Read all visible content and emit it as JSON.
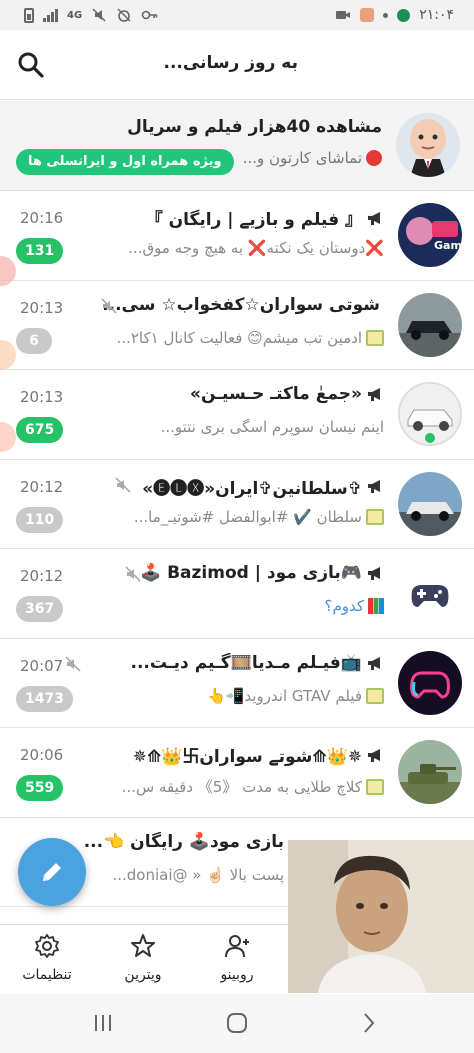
{
  "status_bar": {
    "time": "۲۱:۰۴",
    "network": "4G"
  },
  "header": {
    "title": "به روز رسانی..."
  },
  "ad": {
    "title": "مشاهده 40هزار فیلم و سریال",
    "preview": "تماشای کارتون و...",
    "badge": "ویژه همراه اول و ایرانسلی ها"
  },
  "chats": [
    {
      "title": "『 فیلم و بازیے | رایگان 』",
      "time": "20:16",
      "preview": "❌دوستان یک نکته❌ به هیچ وجه موق...",
      "badge": "131",
      "badge_style": "green",
      "muted": false,
      "avatar_color": "#1b2c5a"
    },
    {
      "title": "شوتی سواران☆کفخواب☆ سی...",
      "time": "20:13",
      "preview": "ادمین تب میشم😊 فعالیت کانال ۱کا۲...",
      "badge": "6",
      "badge_style": "gray",
      "muted": true,
      "avatar_color": "#9aa6a8"
    },
    {
      "title": "«جمعٰ ماکتـ حـسیـن»",
      "time": "20:13",
      "preview": "اینم نیسان سوپرم اسگی بری نتتو...",
      "badge": "675",
      "badge_style": "green",
      "muted": false,
      "avatar_color": "#e6e6e6"
    },
    {
      "title": "✞سلطانین✞ایران«🅔🅛🅧»",
      "time": "20:12",
      "preview": "سلطان ✔️ #ابوالفضل #شوتیـ_ما...",
      "badge": "110",
      "badge_style": "gray",
      "muted": true,
      "avatar_color": "#7fa6c7"
    },
    {
      "title": "🎮بازی مود | Bazimod 🕹️",
      "time": "20:12",
      "preview": "کدوم؟",
      "badge": "367",
      "badge_style": "gray",
      "muted": true,
      "avatar_color": "#ffffff"
    },
    {
      "title": "📺فیـلم مـدیا🎞️گـیم دیـت...",
      "time": "20:07",
      "preview": "فیلم GTAV اندروید📲👆",
      "badge": "1473",
      "badge_style": "gray",
      "muted": true,
      "avatar_color": "#150d24"
    },
    {
      "title": "✵👑⟰شوتے سواران卐👑⟰✵",
      "time": "20:06",
      "preview": "کلاچ طلایی به مدت 《5》 دقیقه س...",
      "badge": "559",
      "badge_style": "green",
      "muted": false,
      "avatar_color": "#6b8a5c"
    },
    {
      "title": "بازی مود🕹️ رایگان 👈...",
      "time": "",
      "preview": "پست بالا ☝🏻 « @doniai...",
      "badge": "",
      "badge_style": "green",
      "muted": false,
      "avatar_color": "#ffffff"
    }
  ],
  "bottom_nav": {
    "items": [
      {
        "label": "روبینو",
        "icon": "profile-icon"
      },
      {
        "label": "ویترین",
        "icon": "star-icon"
      },
      {
        "label": "تنظیمات",
        "icon": "gear-icon"
      }
    ]
  },
  "colors": {
    "accent_green": "#26c267",
    "badge_gray": "#c9c9c9",
    "fab_blue": "#4aa3df"
  }
}
